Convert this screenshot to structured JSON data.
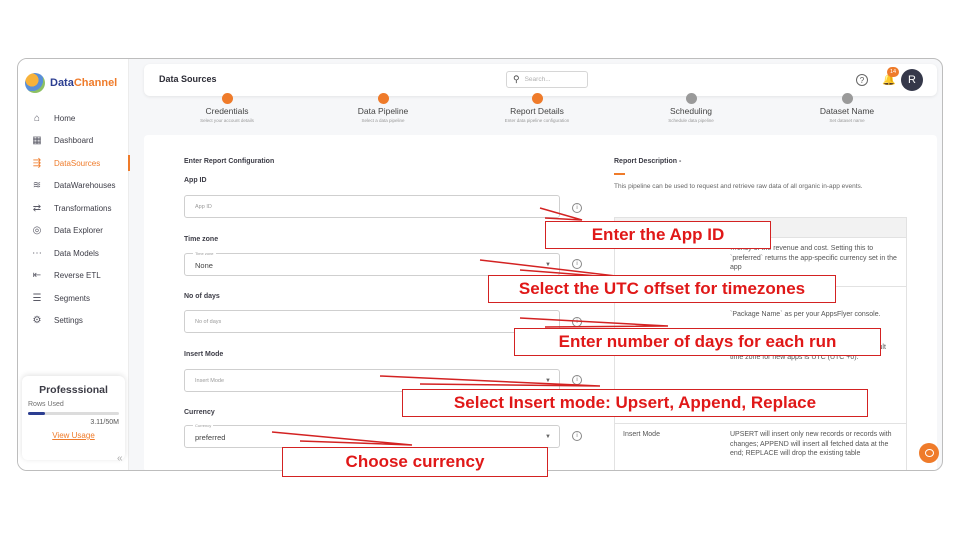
{
  "app": {
    "logo_data": "Data",
    "logo_channel": "Channel"
  },
  "sidebar": {
    "items": [
      {
        "label": "Home",
        "icon": "home-icon",
        "glyph": "⌂"
      },
      {
        "label": "Dashboard",
        "icon": "dashboard-icon",
        "glyph": "▦"
      },
      {
        "label": "DataSources",
        "icon": "datasources-icon",
        "glyph": "⇶"
      },
      {
        "label": "DataWarehouses",
        "icon": "database-icon",
        "glyph": "≋"
      },
      {
        "label": "Transformations",
        "icon": "transform-icon",
        "glyph": "⇄"
      },
      {
        "label": "Data Explorer",
        "icon": "explorer-icon",
        "glyph": "◎"
      },
      {
        "label": "Data Models",
        "icon": "models-icon",
        "glyph": "⋯"
      },
      {
        "label": "Reverse ETL",
        "icon": "reverse-etl-icon",
        "glyph": "⇤"
      },
      {
        "label": "Segments",
        "icon": "segments-icon",
        "glyph": "☰"
      },
      {
        "label": "Settings",
        "icon": "gear-icon",
        "glyph": "⚙"
      }
    ],
    "active_index": 2,
    "plan": {
      "title": "Professsional",
      "rows_label": "Rows Used",
      "usage": "3.11/50M",
      "usage_fraction": 0.0622,
      "link": "View Usage"
    },
    "collapse_glyph": "«"
  },
  "header": {
    "title": "Data Sources",
    "search_placeholder": "Search...",
    "help_glyph": "?",
    "notification_count": "14",
    "avatar_initial": "R"
  },
  "stepper": [
    {
      "name": "Credentials",
      "desc": "Select your account details",
      "done": true
    },
    {
      "name": "Data Pipeline",
      "desc": "Select a data pipeline",
      "done": true
    },
    {
      "name": "Report Details",
      "desc": "Enter data pipeline configuration",
      "done": true
    },
    {
      "name": "Scheduling",
      "desc": "Schedule data pipeline",
      "done": false
    },
    {
      "name": "Dataset Name",
      "desc": "Set dataset name",
      "done": false
    }
  ],
  "form": {
    "section_title": "Enter Report Configuration",
    "app_id": {
      "label": "App ID",
      "placeholder": "App ID"
    },
    "time_zone": {
      "label": "Time zone",
      "floating": "Time zone",
      "value": "None"
    },
    "days": {
      "label": "No of days",
      "placeholder": "No of days"
    },
    "insert_mode": {
      "label": "Insert Mode",
      "placeholder": "Insert Mode"
    },
    "currency": {
      "label": "Currency",
      "floating": "Currency",
      "value": "preferred"
    },
    "info_glyph": "i",
    "caret_glyph": "▼"
  },
  "description": {
    "title": "Report Description -",
    "text": "This pipeline can be used to request and retrieve raw data of all organic in-app events.",
    "table_header_right": "ription",
    "rows": [
      {
        "left": "",
        "right": "…ency of the revenue and cost. Setting this to `preferred` returns the app-specific currency set in the app"
      },
      {
        "left": "",
        "right": "`Package Name` as per your AppsFlyer console."
      },
      {
        "left": "",
        "right": "…used aligned to a custom time zone. The default time zone for new apps is UTC (UTC +0)."
      },
      {
        "left": "Insert Mode",
        "right": "UPSERT will insert only new records or records with changes; APPEND will insert all fetched data at the end; REPLACE will drop the existing table"
      }
    ]
  },
  "annotations": [
    "Enter the App ID",
    "Select the UTC offset for timezones",
    "Enter number of days for each run",
    "Select Insert mode: Upsert, Append, Replace",
    "Choose currency"
  ],
  "colors": {
    "accent": "#ef7b2a",
    "brand": "#2c3e91",
    "annotation": "#e01818"
  }
}
